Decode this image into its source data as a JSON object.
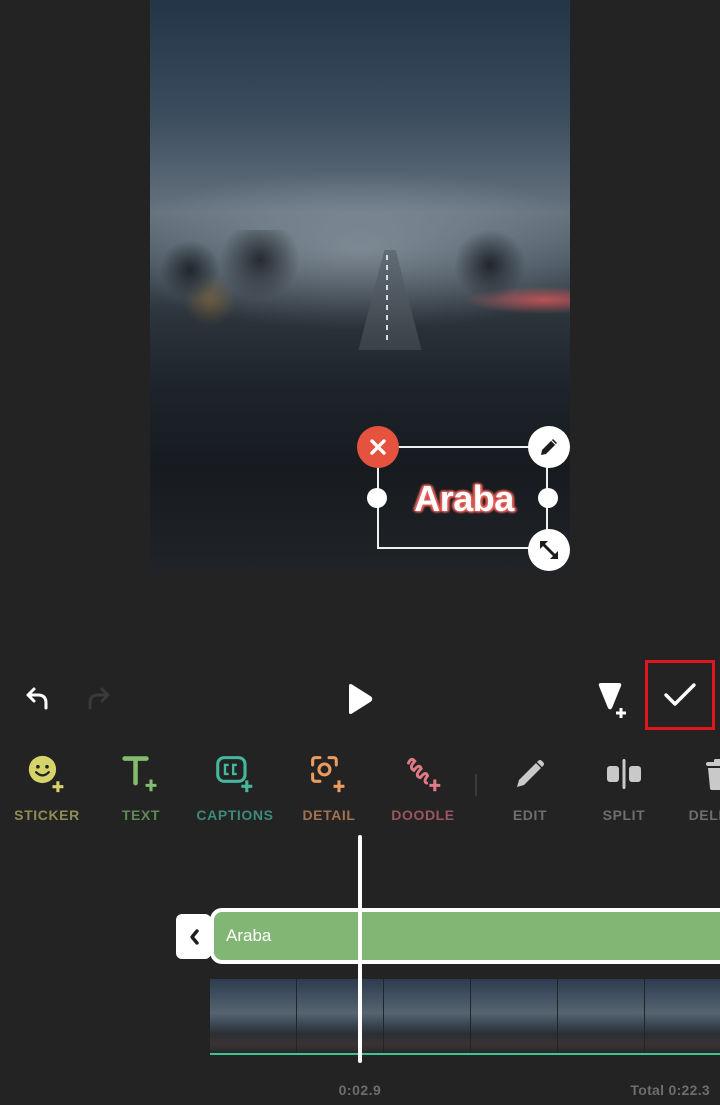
{
  "preview": {
    "overlay_text": "Araba",
    "overlay_text_glow_color": "#e8625a",
    "delete_handle_color": "#e5533f"
  },
  "controls": {
    "undo": "undo-icon",
    "redo": "redo-icon",
    "play": "play-icon",
    "add_keyframe": "add-keyframe-icon",
    "confirm": "checkmark-icon",
    "confirm_highlight_color": "#e0161e"
  },
  "tools": [
    {
      "id": "sticker",
      "label": "STICKER",
      "icon": "sticker-add-icon",
      "color": "#d5d36a",
      "label_color": "#8f8d52"
    },
    {
      "id": "text",
      "label": "TEXT",
      "icon": "text-add-icon",
      "color": "#82bd6e",
      "label_color": "#5e8a55"
    },
    {
      "id": "captions",
      "label": "CAPTIONS",
      "icon": "captions-add-icon",
      "color": "#45b79c",
      "label_color": "#3c8a78"
    },
    {
      "id": "detail",
      "label": "DETAIL",
      "icon": "detail-add-icon",
      "color": "#ec9a5e",
      "label_color": "#a4714f"
    },
    {
      "id": "doodle",
      "label": "DOODLE",
      "icon": "doodle-add-icon",
      "color": "#e07a86",
      "label_color": "#9b5560"
    },
    {
      "id": "edit",
      "label": "EDIT",
      "icon": "pencil-icon",
      "color": "#c9c9c9",
      "label_color": "#6e6e6e"
    },
    {
      "id": "split",
      "label": "SPLIT",
      "icon": "split-icon",
      "color": "#c9c9c9",
      "label_color": "#6e6e6e"
    },
    {
      "id": "delete",
      "label": "DELETE",
      "icon": "trash-icon",
      "color": "#c9c9c9",
      "label_color": "#6e6e6e"
    }
  ],
  "timeline": {
    "text_clip_label": "Araba",
    "text_clip_color": "#82b674",
    "current_time": "0:02.9",
    "total_time": "Total 0:22.3",
    "audio_line_color": "#3fc48f"
  }
}
